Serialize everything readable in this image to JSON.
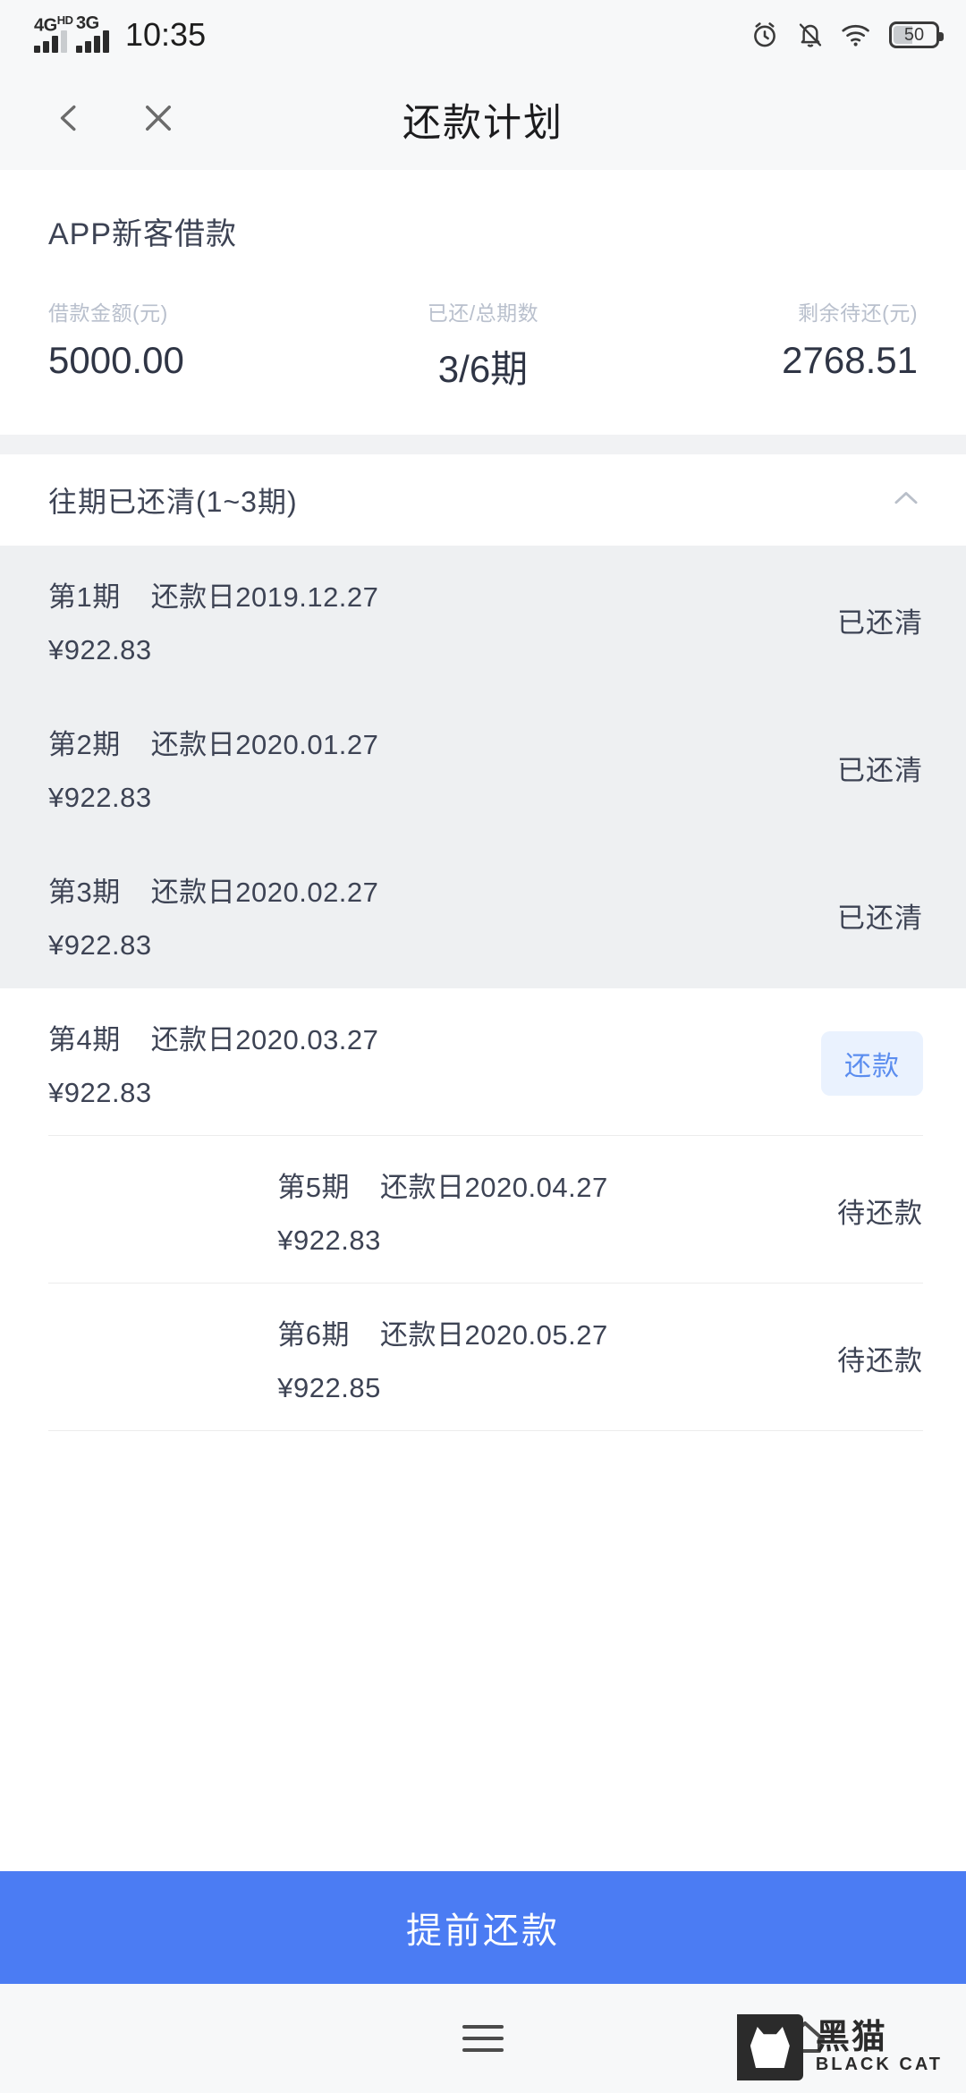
{
  "status_bar": {
    "network_primary": "4G",
    "network_primary_sup": "HD",
    "network_secondary": "3G",
    "time": "10:35",
    "battery_level": "50",
    "icons": [
      "alarm-icon",
      "bell-muted-icon",
      "wifi-icon",
      "battery-icon"
    ]
  },
  "header": {
    "title": "还款计划",
    "back_icon": "chevron-left-icon",
    "close_icon": "close-icon"
  },
  "summary": {
    "product_name": "APP新客借款",
    "stats": [
      {
        "label": "借款金额(元)",
        "value": "5000.00"
      },
      {
        "label": "已还/总期数",
        "value": "3/6期"
      },
      {
        "label": "剩余待还(元)",
        "value": "2768.51"
      }
    ]
  },
  "paid_section": {
    "title": "往期已还清(1~3期)",
    "collapse_icon": "chevron-up-icon",
    "expanded": true
  },
  "installments": [
    {
      "term": "第1期",
      "due_label": "还款日2019.12.27",
      "amount": "¥922.83",
      "status": "已还清",
      "paid": true,
      "action": null
    },
    {
      "term": "第2期",
      "due_label": "还款日2020.01.27",
      "amount": "¥922.83",
      "status": "已还清",
      "paid": true,
      "action": null
    },
    {
      "term": "第3期",
      "due_label": "还款日2020.02.27",
      "amount": "¥922.83",
      "status": "已还清",
      "paid": true,
      "action": null
    },
    {
      "term": "第4期",
      "due_label": "还款日2020.03.27",
      "amount": "¥922.83",
      "status": null,
      "paid": false,
      "action": "还款"
    },
    {
      "term": "第5期",
      "due_label": "还款日2020.04.27",
      "amount": "¥922.83",
      "status": "待还款",
      "paid": false,
      "action": null
    },
    {
      "term": "第6期",
      "due_label": "还款日2020.05.27",
      "amount": "¥922.85",
      "status": "待还款",
      "paid": false,
      "action": null
    }
  ],
  "bottom_action": {
    "label": "提前还款"
  },
  "android_nav": {
    "menu_icon": "menu-icon",
    "home_icon": "home-icon"
  },
  "watermark": {
    "cn": "黑猫",
    "en": "BLACK CAT",
    "logo_icon": "black-cat-logo-icon"
  },
  "colors": {
    "accent_blue": "#4b7cf3",
    "pay_button_bg": "#eaf2fe",
    "pay_button_text": "#5b8def",
    "paid_row_bg": "#eef0f2",
    "text_primary": "#3d4354",
    "text_muted": "#b9c0cd"
  }
}
